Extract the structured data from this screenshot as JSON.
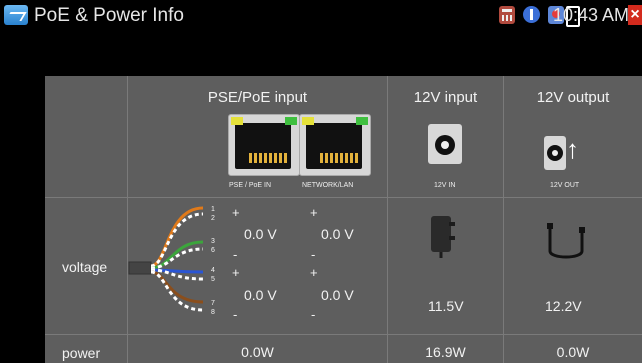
{
  "status_bar": {
    "app_title": "PoE & Power Info",
    "time": "10:43 AM",
    "close_glyph": "×",
    "icons": [
      "app-icon",
      "calculator-icon",
      "notification-icon",
      "tool-icon",
      "battery-icon",
      "close-icon"
    ]
  },
  "table": {
    "headers": {
      "poe": "PSE/PoE input",
      "in12": "12V input",
      "out12": "12V output"
    },
    "port_labels": {
      "pse": "PSE / PoE IN",
      "lan": "NETWORK/LAN",
      "in12": "12V IN",
      "out12": "12V OUT"
    },
    "voltage": {
      "label": "voltage",
      "pair_numbers": [
        "1",
        "2",
        "3",
        "6",
        "4",
        "5",
        "7",
        "8"
      ],
      "signs": {
        "pse_top_plus": "+",
        "pse_mid_minus": "-",
        "pse_low_plus": "+",
        "pse_bot_minus": "-",
        "lan_top_plus": "+",
        "lan_mid_minus": "-",
        "lan_low_plus": "+",
        "lan_bot_minus": "-"
      },
      "pse_v1": "0.0 V",
      "lan_v1": "0.0 V",
      "pse_v2": "0.0 V",
      "lan_v2": "0.0 V",
      "in12": "11.5V",
      "out12": "12.2V"
    },
    "power": {
      "label": "power",
      "poe": "0.0W",
      "in12": "16.9W",
      "out12": "0.0W"
    }
  },
  "colors": {
    "background": "#000000",
    "panel": "#5e5e5e",
    "grid_line": "#7a7a7a",
    "close_button": "#d32a1d",
    "app_icon": "#2a82cf"
  }
}
